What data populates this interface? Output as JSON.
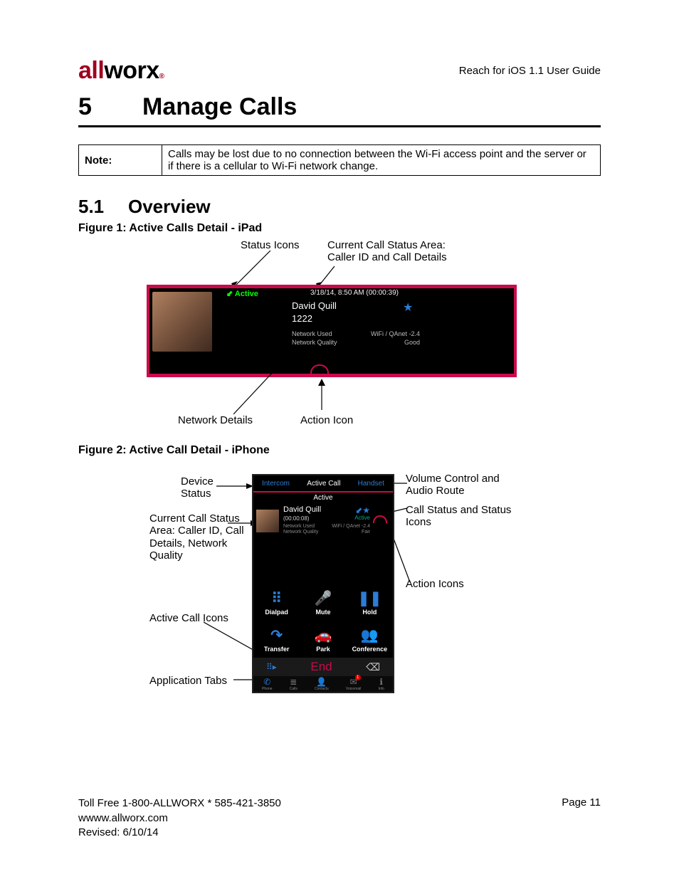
{
  "brand": {
    "part1": "all",
    "part2": "worx",
    "reg": "®"
  },
  "doc_header": "Reach for iOS 1.1 User Guide",
  "chapter": {
    "num": "5",
    "title": "Manage Calls"
  },
  "note": {
    "label": "Note:",
    "text": "Calls may be lost due to no connection between the Wi-Fi access point and the server or if there is a cellular to Wi-Fi network change."
  },
  "section": {
    "num": "5.1",
    "title": "Overview"
  },
  "fig1": {
    "label": "Figure 1: Active Calls Detail - iPad",
    "callouts": {
      "status_icons": "Status Icons",
      "current_call": "Current Call Status Area:\nCaller ID and Call Details",
      "network_details": "Network Details",
      "action_icon": "Action Icon"
    },
    "panel": {
      "status": "Active",
      "timestamp": "3/18/14, 8:50 AM  (00:00:39)",
      "name": "David Quill",
      "ext": "1222",
      "net_used_lbl": "Network Used",
      "net_qual_lbl": "Network Quality",
      "net_used_val": "WiFi / QAnet -2.4",
      "net_qual_val": "Good"
    }
  },
  "fig2": {
    "label": "Figure 2: Active Call Detail - iPhone",
    "callouts": {
      "device_status": "Device\nStatus",
      "current_call": "Current Call Status Area: Caller ID, Call Details, Network Quality",
      "active_call_icons": "Active Call Icons",
      "application_tabs": "Application Tabs",
      "volume": "Volume Control and Audio Route",
      "call_status": "Call Status and Status Icons",
      "action_icons": "Action Icons"
    },
    "panel": {
      "tab_left": "Intercom",
      "tab_mid": "Active Call",
      "tab_right": "Handset",
      "status": "Active",
      "name": "David Quill",
      "duration": "(00:00:08)",
      "active_lbl": "Active",
      "net_used_lbl": "Network Used",
      "net_qual_lbl": "Network Quality",
      "net_used_val": "WiFi / QAnet -2.4",
      "net_qual_val": "Fair",
      "buttons": [
        {
          "icon": "⠿",
          "label": "Dialpad"
        },
        {
          "icon": "🎤",
          "label": "Mute"
        },
        {
          "icon": "❚❚",
          "label": "Hold"
        },
        {
          "icon": "↷",
          "label": "Transfer"
        },
        {
          "icon": "🚗",
          "label": "Park"
        },
        {
          "icon": "👥",
          "label": "Conference"
        }
      ],
      "end": "End",
      "tabs": [
        {
          "icon": "✆",
          "label": "Phone"
        },
        {
          "icon": "≣",
          "label": "Calls"
        },
        {
          "icon": "👤",
          "label": "Contacts"
        },
        {
          "icon": "✉",
          "label": "Voicemail",
          "badge": "1"
        },
        {
          "icon": "ℹ",
          "label": "Info"
        }
      ]
    }
  },
  "footer": {
    "line1": "Toll Free 1-800-ALLWORX * 585-421-3850",
    "line2": "wwww.allworx.com",
    "line3": "Revised: 6/10/14",
    "page": "Page 11"
  }
}
